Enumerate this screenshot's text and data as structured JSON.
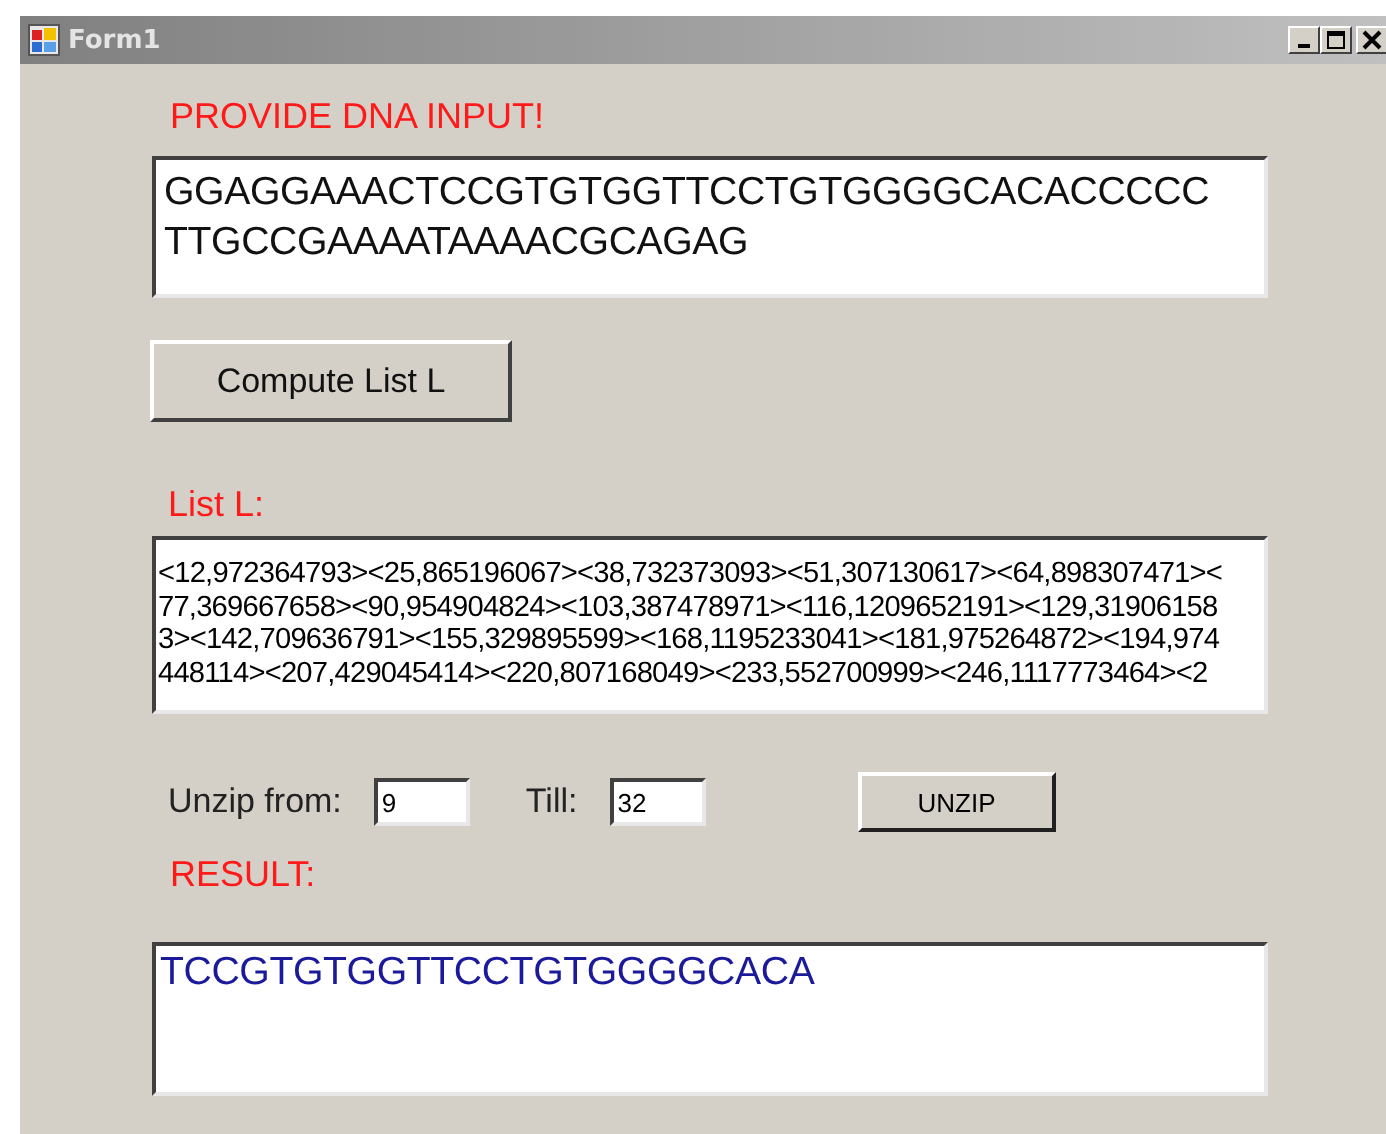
{
  "window": {
    "title": "Form1"
  },
  "dna_label": "PROVIDE DNA INPUT!",
  "dna_input": {
    "lines": [
      "GGAGGAAACTCCGTGTGGTTCCTGTGGGGCACACCCCC",
      "TTGCCGAAAATAAAACGCAGAG"
    ]
  },
  "compute_button": "Compute List L",
  "list_label": "List L:",
  "list_output": {
    "lines": [
      "<12,972364793><25,865196067><38,732373093><51,307130617><64,898307471><",
      "77,369667658><90,954904824><103,387478971><116,1209652191><129,31906158",
      "3><142,709636791><155,329895599><168,1195233041><181,975264872><194,974",
      "448114><207,429045414><220,807168049><233,552700999><246,1117773464><2"
    ]
  },
  "unzip_from": {
    "label": "Unzip from:",
    "value": "9"
  },
  "till": {
    "label": "Till:",
    "value": "32"
  },
  "unzip_button": "UNZIP",
  "result_label": "RESULT:",
  "result_output": {
    "value": "TCCGTGTGGTTCCTGTGGGGCACA"
  }
}
